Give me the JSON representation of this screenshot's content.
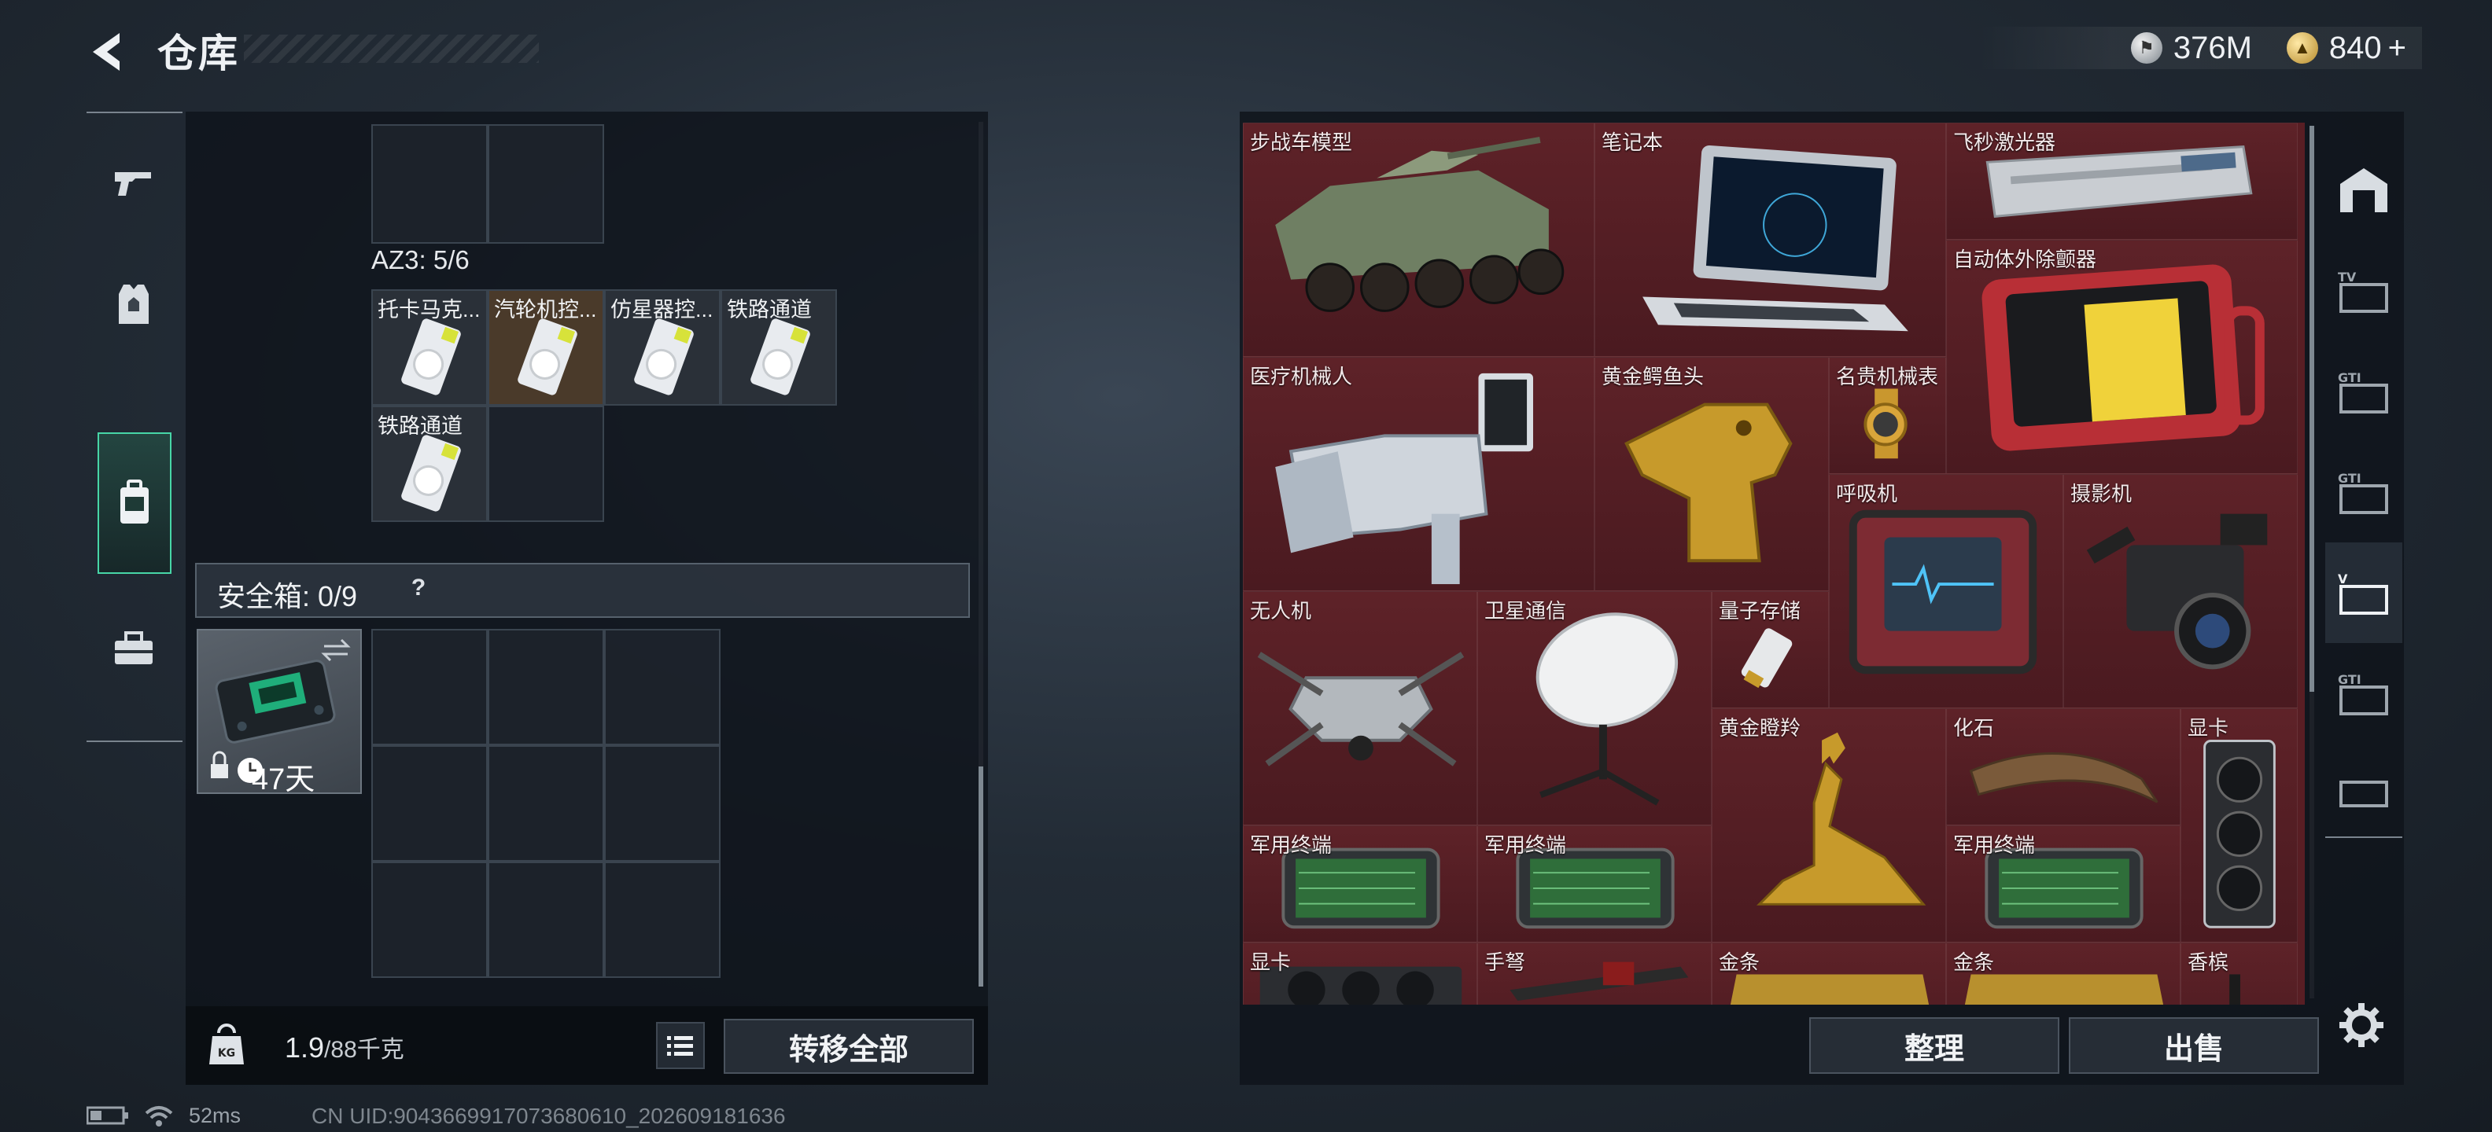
{
  "header": {
    "title": "仓库"
  },
  "currency": {
    "silver": "376M",
    "gold": "840",
    "add_symbol": "+"
  },
  "left_rail": {
    "tabs": [
      "weapon",
      "equipment",
      "storage",
      "toolbox"
    ],
    "active": "storage"
  },
  "backpack": {
    "container_label": "AZ3: 5/6",
    "items": [
      {
        "label": "托卡马克..."
      },
      {
        "label": "汽轮机控..."
      },
      {
        "label": "仿星器控..."
      },
      {
        "label": "铁路通道"
      },
      {
        "label": "铁路通道"
      }
    ]
  },
  "safebox": {
    "label": "安全箱: 0/9",
    "help": "?",
    "duration": "47天"
  },
  "weight": {
    "current": "1.9",
    "max": "/88千克"
  },
  "buttons": {
    "transfer_all": "转移全部",
    "organize": "整理",
    "sell": "出售"
  },
  "warehouse_items": [
    {
      "label": "步战车模型"
    },
    {
      "label": "笔记本"
    },
    {
      "label": "飞秒激光器"
    },
    {
      "label": "自动体外除颤器"
    },
    {
      "label": "医疗机械人"
    },
    {
      "label": "黄金鳄鱼头"
    },
    {
      "label": "名贵机械表"
    },
    {
      "label": "呼吸机"
    },
    {
      "label": "摄影机"
    },
    {
      "label": "无人机"
    },
    {
      "label": "卫星通信"
    },
    {
      "label": "量子存储"
    },
    {
      "label": "黄金瞪羚"
    },
    {
      "label": "化石"
    },
    {
      "label": "显卡"
    },
    {
      "label": "军用终端"
    },
    {
      "label": "军用终端"
    },
    {
      "label": "军用终端"
    },
    {
      "label": "显卡"
    },
    {
      "label": "手弩"
    },
    {
      "label": "金条"
    },
    {
      "label": "金条"
    },
    {
      "label": "香槟"
    }
  ],
  "status_bar": {
    "ping": "52ms",
    "uid": "CN UID:9043669917073680610_202609181636"
  },
  "colors": {
    "accent": "#47d6a7",
    "warehouse_bg": "#581e24"
  }
}
